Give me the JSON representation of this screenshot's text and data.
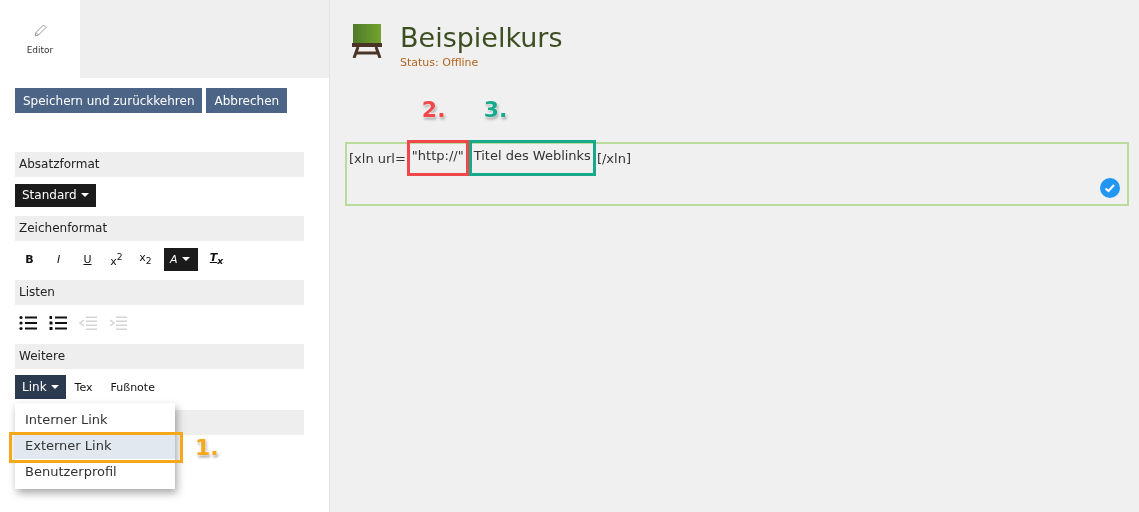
{
  "tab": {
    "label": "Editor",
    "selected": true
  },
  "buttons": [
    "Speichern und zurückkehren",
    "Abbrechen"
  ],
  "paragraph_format": {
    "title": "Absatzformat",
    "value": "Standard"
  },
  "character_format": {
    "title": "Zeichenformat",
    "tools": [
      {
        "kind": "bold",
        "label": "B"
      },
      {
        "kind": "italic",
        "label": "I"
      },
      {
        "kind": "underline",
        "label": "U"
      },
      {
        "kind": "plain",
        "label": "x$^{2}$"
      },
      {
        "kind": "plain",
        "label": "x$_{2}$"
      },
      {
        "kind": "color",
        "label": "A"
      },
      {
        "kind": "clear",
        "label": "T$_{x}$"
      }
    ]
  },
  "lists": {
    "title": "Listen",
    "tools": [
      {
        "kind": "bullets",
        "disabled": false
      },
      {
        "kind": "numbers",
        "disabled": false
      },
      {
        "kind": "outdent",
        "disabled": true
      },
      {
        "kind": "indent",
        "disabled": true
      }
    ]
  },
  "more": {
    "title": "Weitere",
    "tools": [
      {
        "kind": "menu",
        "label": "Link",
        "expanded": true
      },
      {
        "kind": "plain",
        "label": "Tex"
      },
      {
        "kind": "plain",
        "label": "Fußnote"
      }
    ],
    "menu": [
      {
        "label": "Interner Link",
        "selected": false
      },
      {
        "label": "Externer Link",
        "selected": true,
        "marker": {
          "number": "1.",
          "color": "#f5a81c"
        }
      },
      {
        "label": "Benutzerprofil",
        "selected": false
      }
    ]
  },
  "course": {
    "title": "Beispielkurs",
    "status": "Status: Offline"
  },
  "editor": {
    "saved": true,
    "segments": [
      {
        "text": "[xln url="
      },
      {
        "text": "\"http://\"",
        "marker": {
          "number": "2.",
          "color": "#f0474a"
        }
      },
      {
        "text": "Titel des Weblinks",
        "marker": {
          "number": "3.",
          "color": "#16a98c"
        }
      },
      {
        "text": "[/xln]"
      }
    ]
  }
}
